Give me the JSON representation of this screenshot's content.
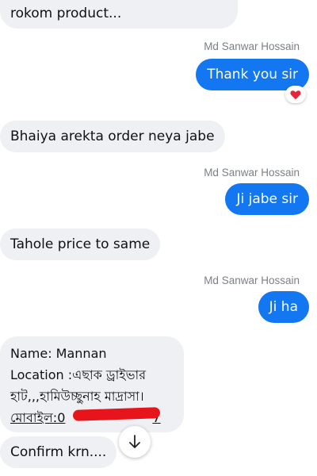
{
  "messages": {
    "m0": {
      "text": "rokom product..."
    },
    "m1": {
      "sender": "Md Sanwar Hossain",
      "text": "Thank you sir",
      "reaction": "heart-icon"
    },
    "m2": {
      "text": "Bhaiya arekta order neya jabe"
    },
    "m3": {
      "sender": "Md Sanwar Hossain",
      "text": "Ji jabe sir"
    },
    "m4": {
      "text": "Tahole price to same"
    },
    "m5": {
      "sender": "Md Sanwar Hossain",
      "text": "Ji ha"
    },
    "m6": {
      "line1": "Name: Mannan",
      "line2": "Location :এছাক ড্রাইভার",
      "line3": "হাট,,,হামিউচ্ছুনাহ মাদ্রাসা।",
      "line4_prefix": "মোবাইল:0",
      "line4_suffix": "7"
    },
    "m7": {
      "text": "Confirm krn...."
    }
  },
  "scroll_button": {
    "icon": "arrow-down-icon"
  },
  "colors": {
    "outgoing": "#1377f2",
    "incoming": "#eef0f3",
    "reaction": "#e8243a",
    "redaction": "#e8141b"
  }
}
